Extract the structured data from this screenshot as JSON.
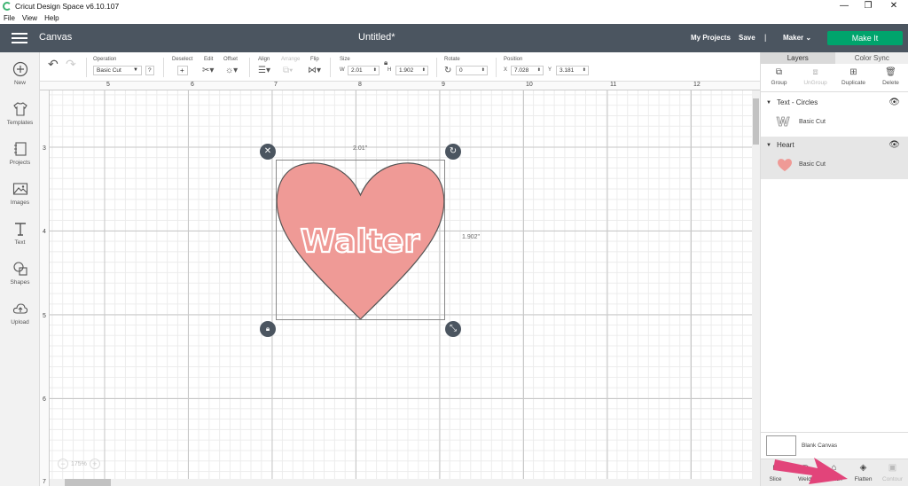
{
  "window": {
    "title": "Cricut Design Space  v6.10.107",
    "controls": {
      "minimize": "—",
      "maximize": "❐",
      "close": "✕"
    }
  },
  "menu": [
    "File",
    "View",
    "Help"
  ],
  "header": {
    "section": "Canvas",
    "document_title": "Untitled*",
    "my_projects": "My Projects",
    "save": "Save",
    "separator": "|",
    "machine": "Maker",
    "make_it": "Make It"
  },
  "sidebar": {
    "items": [
      {
        "label": "New",
        "icon": "plus-circle-icon"
      },
      {
        "label": "Templates",
        "icon": "tshirt-icon"
      },
      {
        "label": "Projects",
        "icon": "notebook-icon"
      },
      {
        "label": "Images",
        "icon": "image-icon"
      },
      {
        "label": "Text",
        "icon": "text-icon"
      },
      {
        "label": "Shapes",
        "icon": "shapes-icon"
      },
      {
        "label": "Upload",
        "icon": "cloud-upload-icon"
      }
    ]
  },
  "toolbar": {
    "operation_label": "Operation",
    "operation_value": "Basic Cut",
    "help": "?",
    "deselect_label": "Deselect",
    "edit_label": "Edit",
    "offset_label": "Offset",
    "align_label": "Align",
    "arrange_label": "Arrange",
    "flip_label": "Flip",
    "size_label": "Size",
    "w_label": "W",
    "width": "2.01",
    "h_label": "H",
    "height": "1.902",
    "rotate_label": "Rotate",
    "rotate": "0",
    "position_label": "Position",
    "x_label": "X",
    "x": "7.028",
    "y_label": "Y",
    "y": "3.181"
  },
  "ruler": {
    "top": [
      "5",
      "6",
      "7",
      "8",
      "9",
      "10",
      "11",
      "12"
    ],
    "left": [
      "3",
      "4",
      "5",
      "6",
      "7"
    ]
  },
  "canvas": {
    "text": "Walter",
    "heart_color": "#ef9a96",
    "width_dim": "2.01\"",
    "height_dim": "1.902\"",
    "zoom": "175%"
  },
  "panel": {
    "tabs": [
      "Layers",
      "Color Sync"
    ],
    "actions": [
      {
        "label": "Group",
        "icon": "group-icon",
        "disabled": false
      },
      {
        "label": "UnGroup",
        "icon": "ungroup-icon",
        "disabled": true
      },
      {
        "label": "Duplicate",
        "icon": "duplicate-icon",
        "disabled": false
      },
      {
        "label": "Delete",
        "icon": "trash-icon",
        "disabled": false
      }
    ],
    "layers": [
      {
        "name": "Text - Circles",
        "item": "Basic Cut",
        "thumb": "W"
      },
      {
        "name": "Heart",
        "item": "Basic Cut",
        "thumb": "heart"
      }
    ],
    "blank_canvas": "Blank Canvas",
    "bottom_actions": [
      {
        "label": "Slice",
        "disabled": false
      },
      {
        "label": "Weld",
        "disabled": false
      },
      {
        "label": "Attach",
        "disabled": false
      },
      {
        "label": "Flatten",
        "disabled": false
      },
      {
        "label": "Contour",
        "disabled": true
      }
    ]
  }
}
